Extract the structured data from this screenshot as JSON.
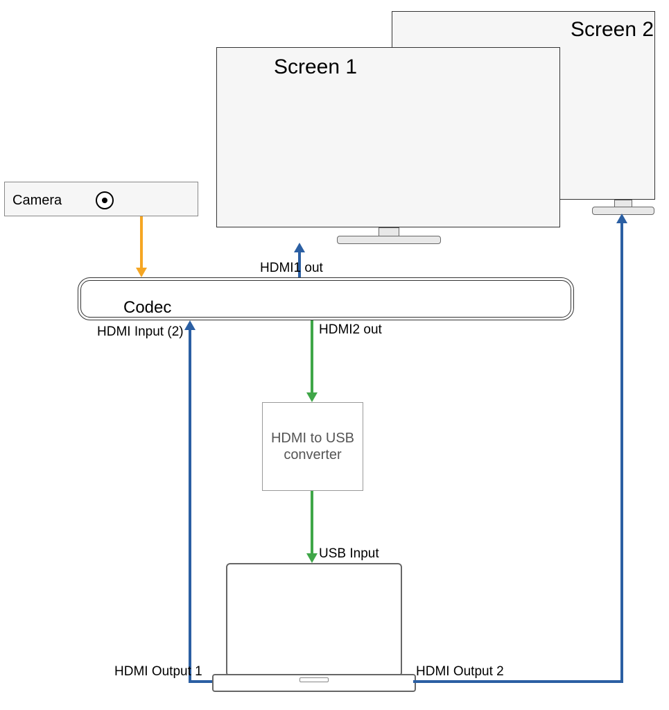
{
  "devices": {
    "camera_label": "Camera",
    "codec_label": "Codec",
    "converter_label": "HDMI to USB converter",
    "screen1_label": "Screen 1",
    "screen2_label": "Screen 2"
  },
  "ports": {
    "hdmi1_out": "HDMI1 out",
    "hdmi2_out": "HDMI2 out",
    "hdmi_input_2": "HDMI Input (2)",
    "usb_input": "USB Input",
    "hdmi_output_1": "HDMI Output 1",
    "hdmi_output_2": "HDMI Output 2"
  },
  "connections": [
    {
      "from": "camera",
      "to": "codec",
      "via": null,
      "color": "orange"
    },
    {
      "from": "codec",
      "to": "screen1",
      "via": "HDMI1 out",
      "color": "blue"
    },
    {
      "from": "codec",
      "to": "converter",
      "via": "HDMI2 out",
      "color": "green"
    },
    {
      "from": "converter",
      "to": "laptop",
      "via": "USB Input",
      "color": "green"
    },
    {
      "from": "laptop",
      "to": "codec",
      "via": "HDMI Output 1 → HDMI Input (2)",
      "color": "blue"
    },
    {
      "from": "laptop",
      "to": "screen2",
      "via": "HDMI Output 2",
      "color": "blue"
    }
  ],
  "colors": {
    "orange": "#f5a623",
    "blue": "#2b5fa3",
    "green": "#3fa648"
  }
}
